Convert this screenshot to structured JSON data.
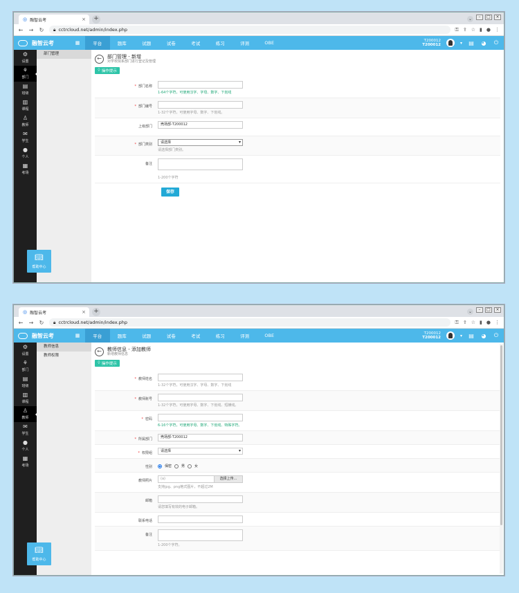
{
  "browser": {
    "tab_title": "融智云考",
    "url": "cctrcloud.net/admin/index.php"
  },
  "brand": {
    "name": "融智云考"
  },
  "topnav": [
    "平台",
    "题库",
    "试题",
    "试卷",
    "考试",
    "练习",
    "评测",
    "OBE"
  ],
  "user": {
    "name": "T200012",
    "id": "T200012"
  },
  "sidebar": [
    {
      "icon": "⚙",
      "label": "设置"
    },
    {
      "icon": "⚘",
      "label": "部门"
    },
    {
      "icon": "▤",
      "label": "班级"
    },
    {
      "icon": "▥",
      "label": "课程"
    },
    {
      "icon": "♙",
      "label": "教师"
    },
    {
      "icon": "✉",
      "label": "学生"
    },
    {
      "icon": "●",
      "label": "个人"
    },
    {
      "icon": "▦",
      "label": "考场"
    }
  ],
  "help_label": "帮助中心",
  "page1": {
    "subnav": [
      "部门管理"
    ],
    "title": "部门管理 - 新增",
    "subtitle": "对学校院系部门进行登记及管理",
    "hint_button": "操作提示",
    "fields": [
      {
        "label": "部门名称",
        "required": true,
        "value": "",
        "hint": "1-64个字符，可使用汉字、字母、数字、下划线"
      },
      {
        "label": "部门编号",
        "required": true,
        "value": "",
        "hint": "1-32个字符，可使用字母、数字、下划线。"
      },
      {
        "label": "上级部门",
        "required": false,
        "value": "壳场部-T200012",
        "hint": ""
      },
      {
        "label": "部门类别",
        "required": true,
        "value": "请选择",
        "hint": "请选择部门类别。"
      },
      {
        "label": "备注",
        "required": false,
        "value": "",
        "hint": "1-200个字符"
      }
    ],
    "save_label": "保存"
  },
  "page2": {
    "subnav": [
      "教师信息",
      "教师权限"
    ],
    "title": "教师信息 - 添加教师",
    "subtitle": "新增教师信息",
    "hint_button": "操作提示",
    "fields": [
      {
        "label": "教师姓名",
        "required": true,
        "value": "",
        "hint": "1-32个字符，可使用汉字、字母、数字、下划线"
      },
      {
        "label": "教师账号",
        "required": true,
        "value": "",
        "hint": "1-32个字符，可使用字母、数字、下划线、短横线。"
      },
      {
        "label": "密码",
        "required": true,
        "value": "",
        "hint": "6-16个字符，可使用字母、数字、下划线、特殊字符。"
      },
      {
        "label": "所属部门",
        "required": true,
        "value": "壳场部-T200012",
        "hint": ""
      },
      {
        "label": "权限组",
        "required": true,
        "value": "请选择",
        "hint": ""
      },
      {
        "label": "性别",
        "required": false,
        "options": [
          "保密",
          "男",
          "女"
        ],
        "selected": "保密"
      },
      {
        "label": "教师照片",
        "required": false,
        "file_name": "(a)",
        "file_button": "选择上传...",
        "hint": "支持jpg、png格式图片，不超过2M"
      },
      {
        "label": "邮箱",
        "required": false,
        "value": "",
        "hint": "请您填写有效的电子邮箱。"
      },
      {
        "label": "联系电话",
        "required": false,
        "value": "",
        "hint": ""
      },
      {
        "label": "备注",
        "required": false,
        "value": "",
        "hint": "1-200个字符。"
      }
    ]
  },
  "colors": {
    "primary": "#4db8ea",
    "sidebar": "#1f1f1f",
    "hint_button": "#2ec4a8",
    "save_button": "#22a9d6"
  }
}
